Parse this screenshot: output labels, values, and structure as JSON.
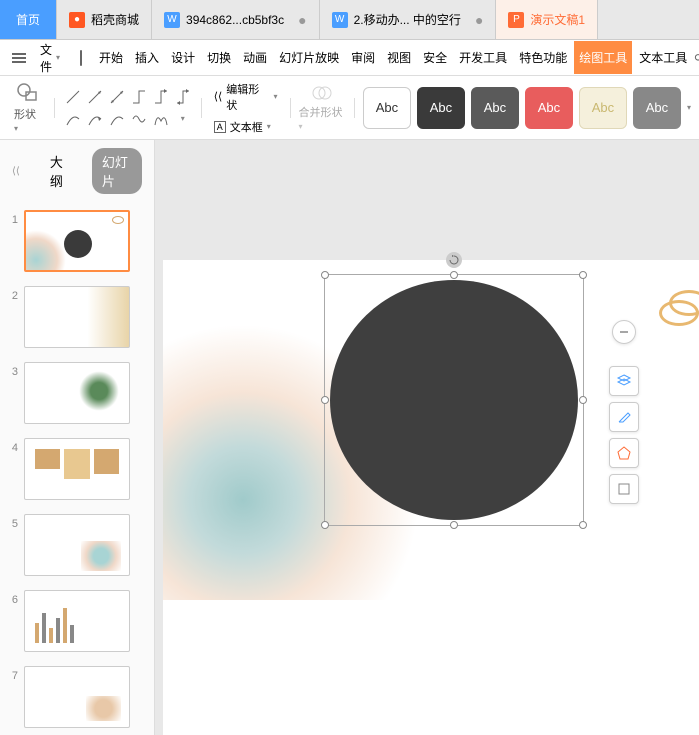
{
  "tabs": {
    "home": "首页",
    "store": "稻壳商城",
    "doc1": "394c862...cb5bf3c",
    "doc2": "2.移动办... 中的空行",
    "doc3": "演示文稿1"
  },
  "file_menu": "文件",
  "ribbon": {
    "start": "开始",
    "insert": "插入",
    "design": "设计",
    "transition": "切换",
    "animation": "动画",
    "slideshow": "幻灯片放映",
    "review": "审阅",
    "view": "视图",
    "security": "安全",
    "devtools": "开发工具",
    "features": "特色功能",
    "drawtools": "绘图工具",
    "texttools": "文本工具"
  },
  "search": "查找",
  "toolbar": {
    "shape": "形状",
    "edit_shape": "编辑形状",
    "text_box": "文本框",
    "merge_shape": "合并形状",
    "preset_label": "Abc"
  },
  "panel": {
    "outline": "大纲",
    "slides": "幻灯片"
  },
  "slide_numbers": [
    "1",
    "2",
    "3",
    "4",
    "5",
    "6",
    "7"
  ]
}
